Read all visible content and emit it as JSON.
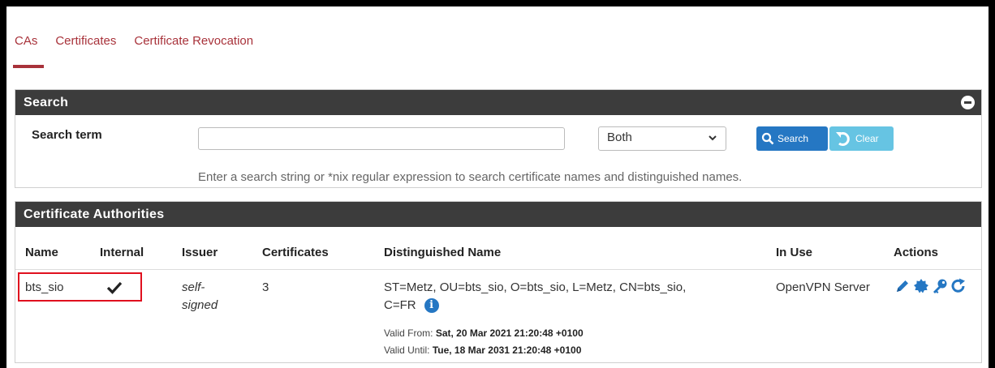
{
  "tabs": [
    {
      "label": "CAs",
      "active": true
    },
    {
      "label": "Certificates",
      "active": false
    },
    {
      "label": "Certificate Revocation",
      "active": false
    }
  ],
  "search": {
    "title": "Search",
    "term_label": "Search term",
    "input_value": "",
    "select_value": "Both",
    "search_button": "Search",
    "clear_button": "Clear",
    "help_text": "Enter a search string or *nix regular expression to search certificate names and distinguished names."
  },
  "ca": {
    "title": "Certificate Authorities",
    "columns": [
      "Name",
      "Internal",
      "Issuer",
      "Certificates",
      "Distinguished Name",
      "In Use",
      "Actions"
    ],
    "row": {
      "name": "bts_sio",
      "internal_icon": "checkmark-icon",
      "issuer_line1": "self-",
      "issuer_line2": "signed",
      "certificates": "3",
      "dn_line1": "ST=Metz, OU=bts_sio, O=bts_sio, L=Metz, CN=bts_sio,",
      "dn_line2": "C=FR",
      "info_glyph": "i",
      "valid_from_label": "Valid From:",
      "valid_from": "Sat, 20 Mar 2021 21:20:48 +0100",
      "valid_until_label": "Valid Until:",
      "valid_until": "Tue, 18 Mar 2031 21:20:48 +0100",
      "in_use": "OpenVPN Server",
      "action_icons": [
        "pencil-icon",
        "certificate-badge-icon",
        "key-icon",
        "renew-icon"
      ]
    }
  },
  "colors": {
    "accent": "#a8323a",
    "panel_header": "#3c3c3c",
    "primary": "#2577c3",
    "info": "#66c4e3",
    "highlight": "#e0101e"
  }
}
